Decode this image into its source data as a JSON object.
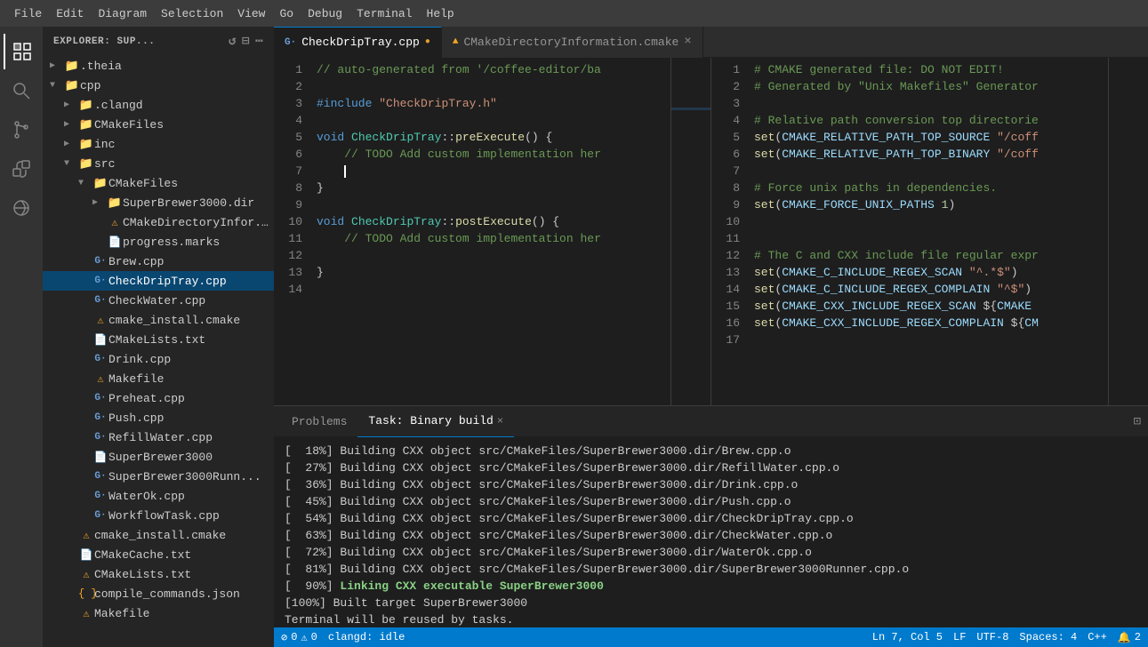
{
  "menubar": {
    "items": [
      "File",
      "Edit",
      "Diagram",
      "Selection",
      "View",
      "Go",
      "Debug",
      "Terminal",
      "Help"
    ]
  },
  "sidebar": {
    "title": "EXPLORER: SUP...",
    "tree": [
      {
        "id": "theia",
        "label": ".theia",
        "type": "folder",
        "depth": 0,
        "open": false
      },
      {
        "id": "cpp",
        "label": "cpp",
        "type": "folder",
        "depth": 0,
        "open": true
      },
      {
        "id": "clangd",
        "label": ".clangd",
        "type": "folder",
        "depth": 1,
        "open": false
      },
      {
        "id": "CMakeFiles",
        "label": "CMakeFiles",
        "type": "folder",
        "depth": 1,
        "open": false
      },
      {
        "id": "inc",
        "label": "inc",
        "type": "folder",
        "depth": 1,
        "open": false
      },
      {
        "id": "src",
        "label": "src",
        "type": "folder",
        "depth": 1,
        "open": true
      },
      {
        "id": "CMakeFiles2",
        "label": "CMakeFiles",
        "type": "folder",
        "depth": 2,
        "open": true
      },
      {
        "id": "SuperBrewer3000dir",
        "label": "SuperBrewer3000.dir",
        "type": "folder",
        "depth": 3,
        "open": false
      },
      {
        "id": "CMakeDirInfo",
        "label": "CMakeDirectoryInfor...",
        "type": "cmake-warn",
        "depth": 4
      },
      {
        "id": "progress",
        "label": "progress.marks",
        "type": "marks",
        "depth": 4
      },
      {
        "id": "Brew",
        "label": "Brew.cpp",
        "type": "cpp",
        "depth": 3
      },
      {
        "id": "CheckDripTray",
        "label": "CheckDripTray.cpp",
        "type": "cpp",
        "depth": 3,
        "selected": true
      },
      {
        "id": "CheckWater",
        "label": "CheckWater.cpp",
        "type": "cpp",
        "depth": 3
      },
      {
        "id": "cmake_install",
        "label": "cmake_install.cmake",
        "type": "cmake-warn",
        "depth": 3
      },
      {
        "id": "CMakeLists2",
        "label": "CMakeLists.txt",
        "type": "txt",
        "depth": 3
      },
      {
        "id": "Drink",
        "label": "Drink.cpp",
        "type": "cpp",
        "depth": 3
      },
      {
        "id": "Makefile2",
        "label": "Makefile",
        "type": "makefile",
        "depth": 3
      },
      {
        "id": "Preheat",
        "label": "Preheat.cpp",
        "type": "cpp",
        "depth": 3
      },
      {
        "id": "Push",
        "label": "Push.cpp",
        "type": "cpp",
        "depth": 3
      },
      {
        "id": "RefillWater",
        "label": "RefillWater.cpp",
        "type": "cpp",
        "depth": 3
      },
      {
        "id": "SuperBrewer3000",
        "label": "SuperBrewer3000",
        "type": "exe",
        "depth": 3
      },
      {
        "id": "SuperBrewer3000Runner",
        "label": "SuperBrewer3000Runn...",
        "type": "cpp",
        "depth": 3
      },
      {
        "id": "WaterOk",
        "label": "WaterOk.cpp",
        "type": "cpp",
        "depth": 3
      },
      {
        "id": "WorkflowTask",
        "label": "WorkflowTask.cpp",
        "type": "cpp",
        "depth": 3
      },
      {
        "id": "cmake_install2",
        "label": "cmake_install.cmake",
        "type": "cmake-warn",
        "depth": 2
      },
      {
        "id": "CMakeCache",
        "label": "CMakeCache.txt",
        "type": "txt",
        "depth": 2
      },
      {
        "id": "CMakeLists3",
        "label": "CMakeLists.txt",
        "type": "cmake-warn",
        "depth": 2
      },
      {
        "id": "compile_commands",
        "label": "compile_commands.json",
        "type": "json",
        "depth": 2
      },
      {
        "id": "Makefile3",
        "label": "Makefile",
        "type": "makefile",
        "depth": 2
      }
    ]
  },
  "tabs": {
    "left": {
      "icon": "G",
      "filename": "CheckDripTray.cpp",
      "modified": true,
      "language": "cpp"
    },
    "right": {
      "icon": "cmake",
      "filename": "CMakeDirectoryInformation.cmake",
      "closable": true,
      "language": "cmake"
    }
  },
  "editor_left": {
    "lines": [
      {
        "num": 1,
        "content": "// auto-generated from '/coffee-editor/ba"
      },
      {
        "num": 2,
        "content": ""
      },
      {
        "num": 3,
        "content": "#include \"CheckDripTray.h\""
      },
      {
        "num": 4,
        "content": ""
      },
      {
        "num": 5,
        "content": "void CheckDripTray::preExecute() {"
      },
      {
        "num": 6,
        "content": "    // TODO Add custom implementation her"
      },
      {
        "num": 7,
        "content": "    "
      },
      {
        "num": 8,
        "content": "}"
      },
      {
        "num": 9,
        "content": ""
      },
      {
        "num": 10,
        "content": "void CheckDripTray::postExecute() {"
      },
      {
        "num": 11,
        "content": "    // TODO Add custom implementation her"
      },
      {
        "num": 12,
        "content": ""
      },
      {
        "num": 13,
        "content": "}"
      },
      {
        "num": 14,
        "content": ""
      }
    ]
  },
  "editor_right": {
    "lines": [
      {
        "num": 1,
        "content": "# CMAKE generated file: DO NOT EDIT!"
      },
      {
        "num": 2,
        "content": "# Generated by \"Unix Makefiles\" Generator"
      },
      {
        "num": 3,
        "content": ""
      },
      {
        "num": 4,
        "content": "# Relative path conversion top directorie"
      },
      {
        "num": 5,
        "content": "set(CMAKE_RELATIVE_PATH_TOP_SOURCE \"/coff"
      },
      {
        "num": 6,
        "content": "set(CMAKE_RELATIVE_PATH_TOP_BINARY \"/coff"
      },
      {
        "num": 7,
        "content": ""
      },
      {
        "num": 8,
        "content": "# Force unix paths in dependencies."
      },
      {
        "num": 9,
        "content": "set(CMAKE_FORCE_UNIX_PATHS 1)"
      },
      {
        "num": 10,
        "content": ""
      },
      {
        "num": 11,
        "content": ""
      },
      {
        "num": 12,
        "content": "# The C and CXX include file regular expr"
      },
      {
        "num": 13,
        "content": "set(CMAKE_C_INCLUDE_REGEX_SCAN \"^.*$\")"
      },
      {
        "num": 14,
        "content": "set(CMAKE_C_INCLUDE_REGEX_COMPLAIN \"^$\")"
      },
      {
        "num": 15,
        "content": "set(CMAKE_CXX_INCLUDE_REGEX_SCAN ${CMAKE"
      },
      {
        "num": 16,
        "content": "set(CMAKE_CXX_INCLUDE_REGEX_COMPLAIN ${CM"
      },
      {
        "num": 17,
        "content": ""
      }
    ]
  },
  "terminal": {
    "tabs": [
      {
        "label": "Problems",
        "active": false
      },
      {
        "label": "Task: Binary build",
        "active": true,
        "closable": true
      }
    ],
    "output": [
      {
        "text": "[  18%] Building CXX object src/CMakeFiles/SuperBrewer3000.dir/Brew.cpp.o",
        "pct": "  18%"
      },
      {
        "text": "[  27%] Building CXX object src/CMakeFiles/SuperBrewer3000.dir/RefillWater.cpp.o",
        "pct": "  27%"
      },
      {
        "text": "[  36%] Building CXX object src/CMakeFiles/SuperBrewer3000.dir/Drink.cpp.o",
        "pct": "  36%"
      },
      {
        "text": "[  45%] Building CXX object src/CMakeFiles/SuperBrewer3000.dir/Push.cpp.o",
        "pct": "  45%"
      },
      {
        "text": "[  54%] Building CXX object src/CMakeFiles/SuperBrewer3000.dir/CheckDripTray.cpp.o",
        "pct": "  54%"
      },
      {
        "text": "[  63%] Building CXX object src/CMakeFiles/SuperBrewer3000.dir/CheckWater.cpp.o",
        "pct": "  63%"
      },
      {
        "text": "[  72%] Building CXX object src/CMakeFiles/SuperBrewer3000.dir/WaterOk.cpp.o",
        "pct": "  72%"
      },
      {
        "text": "[  81%] Building CXX object src/CMakeFiles/SuperBrewer3000.dir/SuperBrewer3000Runner.cpp.o",
        "pct": "  81%"
      },
      {
        "text": "[  90%] Linking CXX executable SuperBrewer3000",
        "pct": "  90%",
        "bold": true
      },
      {
        "text": "[100%] Built target SuperBrewer3000",
        "pct": "100%"
      },
      {
        "text": ""
      },
      {
        "text": "Terminal will be reused by tasks."
      }
    ]
  },
  "statusbar": {
    "errors": "0",
    "warnings": "0",
    "clangd": "clangd: idle",
    "position": "Ln 7, Col 5",
    "eol": "LF",
    "encoding": "UTF-8",
    "spaces": "Spaces: 4",
    "language": "C++"
  }
}
